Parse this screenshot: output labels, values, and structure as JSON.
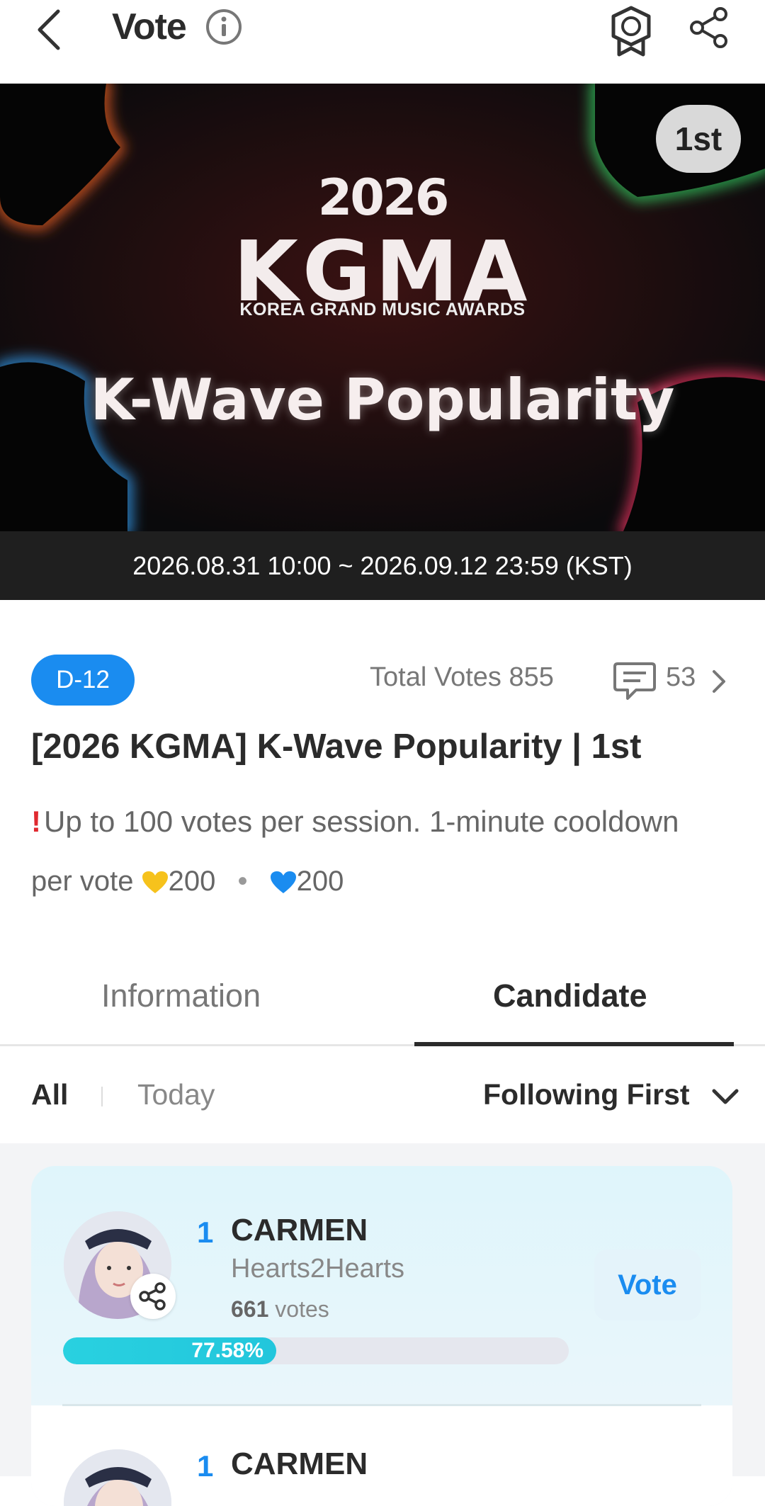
{
  "header": {
    "title": "Vote",
    "icons": [
      "back-arrow-icon",
      "info-icon",
      "medal-icon",
      "share-icon"
    ]
  },
  "banner": {
    "year": "2026",
    "logo": "KGMA",
    "logo_sub": "KOREA GRAND MUSIC AWARDS",
    "title": "K-Wave Popularity",
    "rank_badge": "1st",
    "period": "2026.08.31 10:00 ~ 2026.09.12 23:59 (KST)"
  },
  "summary": {
    "dday": "D-12",
    "total_votes": "Total Votes 855",
    "comments": "53",
    "title": "[2026 KGMA] K-Wave Popularity | 1st",
    "notice_mark": "!",
    "notice": "Up to 100 votes per session. 1-minute cooldown",
    "price_prefix": "per vote",
    "price_gold": "200",
    "price_dot": "•",
    "price_blue": "200",
    "colors": {
      "accent": "#1a8cf0",
      "gold": "#f6c21c",
      "alert": "#e0292f"
    }
  },
  "tabs": [
    {
      "label": "Information",
      "active": false
    },
    {
      "label": "Candidate",
      "active": true
    }
  ],
  "filters": {
    "all": "All",
    "today": "Today",
    "sort": "Following First"
  },
  "candidates": [
    {
      "rank": "1",
      "name": "CARMEN",
      "group": "Hearts2Hearts",
      "votes_count": "661",
      "votes_unit": "votes",
      "percent_label": "77.58%",
      "percent": 77.58,
      "vote_button": "Vote"
    },
    {
      "rank": "1",
      "name": "CARMEN"
    }
  ]
}
